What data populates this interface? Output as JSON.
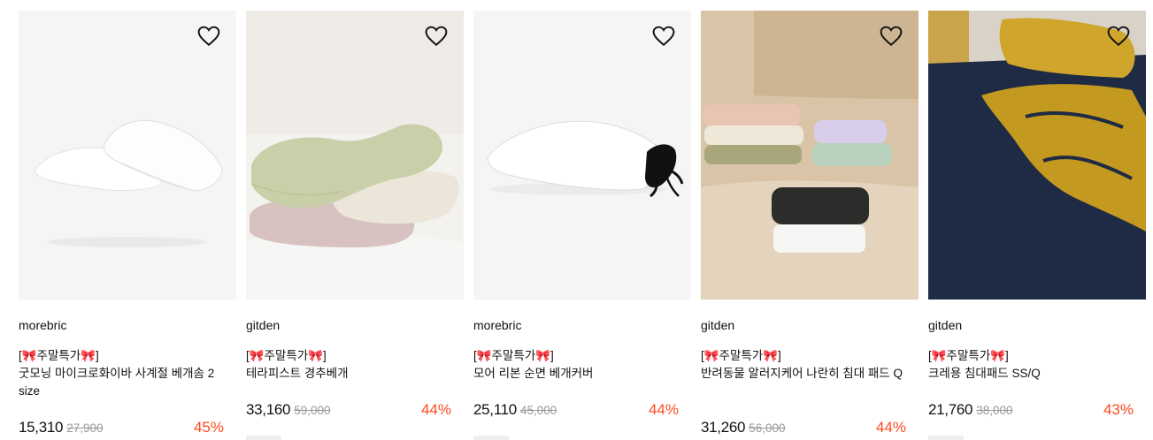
{
  "colors": {
    "discount": "#ff4a1f",
    "original_price": "#999999",
    "ribbon_emoji": "#e0245e"
  },
  "icons": {
    "wishlist": "heart-outline-icon",
    "promo": "ribbon-icon"
  },
  "products": [
    {
      "brand": "morebric",
      "promo": "[🎀주말특가🎀]",
      "name": "굿모닝 마이크로화이바 사계절 베개솜 2 size",
      "price": "15,310",
      "original_price": "27,900",
      "discount": "45%"
    },
    {
      "brand": "gitden",
      "promo": "[🎀주말특가🎀]",
      "name": "테라피스트 경추베개",
      "price": "33,160",
      "original_price": "59,000",
      "discount": "44%"
    },
    {
      "brand": "morebric",
      "promo": "[🎀주말특가🎀]",
      "name": "모어 리본 순면 베개커버",
      "price": "25,110",
      "original_price": "45,000",
      "discount": "44%"
    },
    {
      "brand": "gitden",
      "promo": "[🎀주말특가🎀]",
      "name": "반려동물 알러지케어 나란히 침대 패드 Q",
      "price": "31,260",
      "original_price": "56,000",
      "discount": "44%"
    },
    {
      "brand": "gitden",
      "promo": "[🎀주말특가🎀]",
      "name": "크레용 침대패드 SS/Q",
      "price": "21,760",
      "original_price": "38,000",
      "discount": "43%"
    }
  ]
}
